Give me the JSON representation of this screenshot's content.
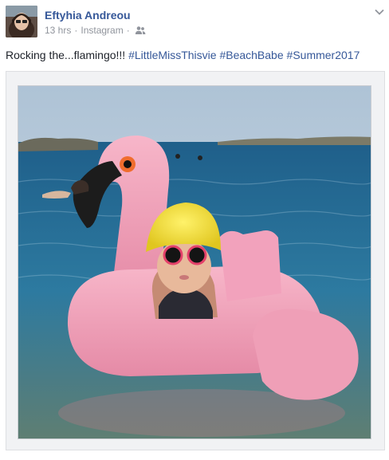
{
  "post": {
    "author": "Eftyhia Andreou",
    "time": "13 hrs",
    "separator": "·",
    "source": "Instagram",
    "privacy_icon": "friends-icon",
    "options_icon": "chevron-down-icon",
    "caption_text": "Rocking the...flamingo!!! ",
    "hashtags": [
      "#LittleMissThisvie",
      "#BeachBabe",
      "#Summer2017"
    ]
  },
  "colors": {
    "link": "#365899",
    "meta": "#90949c",
    "text": "#1d2129"
  }
}
